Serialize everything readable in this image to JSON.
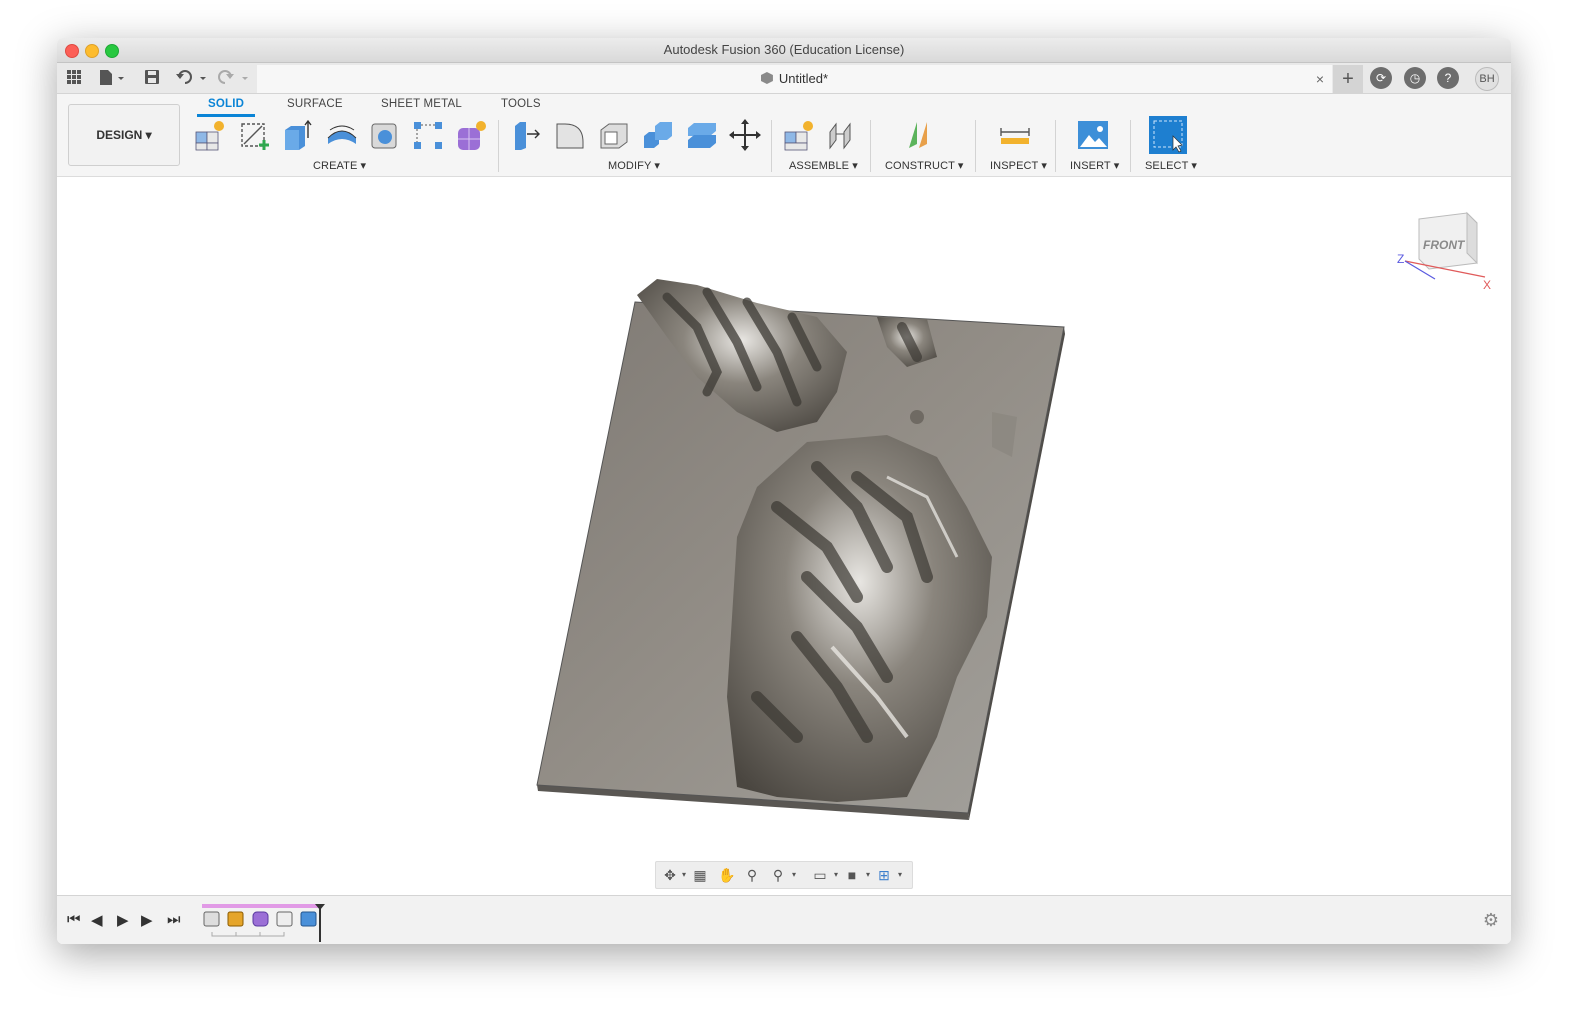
{
  "window": {
    "title": "Autodesk Fusion 360 (Education License)"
  },
  "tabbar": {
    "document_tab": "Untitled*",
    "close_glyph": "×",
    "add_glyph": "+",
    "user_initials": "BH",
    "help_glyph": "?"
  },
  "toolbar": {
    "workspace": "DESIGN ▾",
    "tabs": [
      "SOLID",
      "SURFACE",
      "SHEET METAL",
      "TOOLS"
    ],
    "groups": {
      "create": "CREATE ▾",
      "modify": "MODIFY ▾",
      "assemble": "ASSEMBLE ▾",
      "construct": "CONSTRUCT ▾",
      "inspect": "INSPECT ▾",
      "insert": "INSERT ▾",
      "select": "SELECT ▾"
    }
  },
  "viewcube": {
    "face_label": "FRONT",
    "axis_x": "X",
    "axis_z": "Z"
  },
  "colors": {
    "accent": "#0a84d6",
    "timeline_bar": "#e19ae6",
    "terrain": "#8f8a83"
  },
  "timeline": {
    "features": [
      "sketch-icon",
      "mesh-icon",
      "form-icon",
      "sketch-edit-icon",
      "extrude-icon"
    ]
  }
}
